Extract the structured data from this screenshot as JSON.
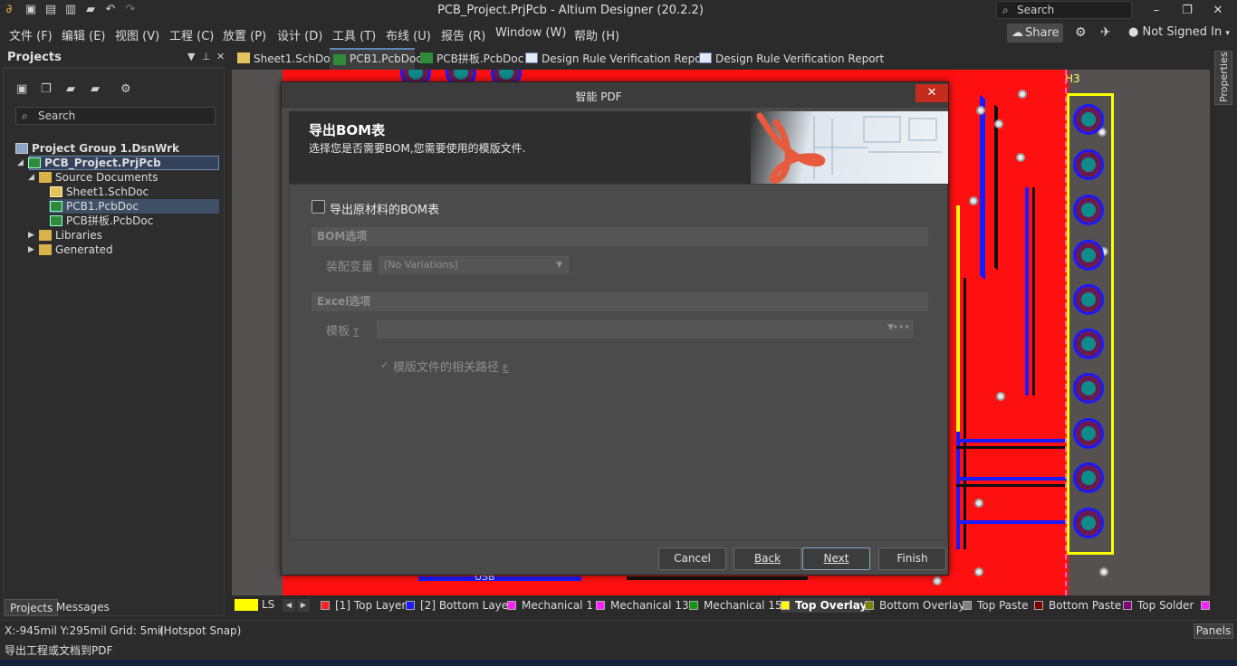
{
  "app": {
    "title": "PCB_Project.PrjPcb - Altium Designer (20.2.2)",
    "search_label": "Search"
  },
  "menu": [
    "文件 (F)",
    "编辑 (E)",
    "视图 (V)",
    "工程 (C)",
    "放置 (P)",
    "设计 (D)",
    "工具 (T)",
    "布线 (U)",
    "报告 (R)",
    "Window (W)",
    "帮助 (H)"
  ],
  "topright": {
    "share_label": "Share",
    "signin_label": "Not Signed In"
  },
  "doc_tabs": [
    {
      "label": "Sheet1.SchDoc",
      "kind": "sch"
    },
    {
      "label": "PCB1.PcbDoc",
      "kind": "pcb",
      "active": true
    },
    {
      "label": "PCB拼板.PcbDoc",
      "kind": "pcb"
    },
    {
      "label": "Design Rule Verification Report",
      "kind": "report"
    },
    {
      "label": "Design Rule Verification Report",
      "kind": "report"
    }
  ],
  "projects_panel": {
    "title": "Projects",
    "search_placeholder": "Search",
    "tree": [
      {
        "label": "Project Group 1.DsnWrk",
        "level": 0,
        "bold": true
      },
      {
        "label": "PCB_Project.PrjPcb",
        "level": 1,
        "bold": true
      },
      {
        "label": "Source Documents",
        "level": 2
      },
      {
        "label": "Sheet1.SchDoc",
        "level": 3
      },
      {
        "label": "PCB1.PcbDoc",
        "level": 3,
        "selected": true
      },
      {
        "label": "PCB拼板.PcbDoc",
        "level": 3
      },
      {
        "label": "Libraries",
        "level": 2
      },
      {
        "label": "Generated",
        "level": 2
      }
    ],
    "bottom_tabs": [
      "Projects",
      "Messages"
    ]
  },
  "canvas": {
    "designator": "H3",
    "usb_label": "USB"
  },
  "properties_tab": "Properties",
  "layers": {
    "ls_label": "LS",
    "items": [
      {
        "label": "[1] Top Layer",
        "color": "#ff2020"
      },
      {
        "label": "[2] Bottom Layer",
        "color": "#1a1aff"
      },
      {
        "label": "Mechanical 1",
        "color": "#ff20ff"
      },
      {
        "label": "Mechanical 13",
        "color": "#ff20ff"
      },
      {
        "label": "Mechanical 15",
        "color": "#109910"
      },
      {
        "label": "Top Overlay",
        "color": "#ffff00",
        "active": true
      },
      {
        "label": "Bottom Overlay",
        "color": "#808000"
      },
      {
        "label": "Top Paste",
        "color": "#808080"
      },
      {
        "label": "Bottom Paste",
        "color": "#800000"
      },
      {
        "label": "Top Solder",
        "color": "#800080"
      }
    ]
  },
  "status": {
    "coords": "X:-945mil Y:295mil   Grid: 5mil",
    "snap": "(Hotspot Snap)",
    "panels_label": "Panels",
    "message": "导出工程或文档到PDF"
  },
  "dialog": {
    "title": "智能 PDF",
    "heading": "导出BOM表",
    "subheading": "选择您是否需要BOM,您需要使用的模版文件.",
    "export_bom_label": "导出原材料的BOM表",
    "export_bom_checked": false,
    "bom_section": "BOM选项",
    "variant_label": "装配变量",
    "variant_value": "[No Variations]",
    "excel_section": "Excel选项",
    "template_label": "模板",
    "template_shortcut": "T",
    "template_value": "",
    "relative_path_label": "模版文件的相关路径",
    "relative_path_shortcut": "E",
    "relative_path_checked": true,
    "buttons": {
      "cancel": "Cancel",
      "back": "Back",
      "next": "Next",
      "finish": "Finish"
    }
  }
}
